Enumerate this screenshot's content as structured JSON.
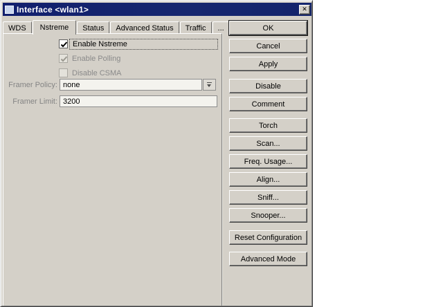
{
  "colors": {
    "titlebar_blue": "#16276f",
    "dialog_bg": "#d4d0c8",
    "field_bg": "#f4f3ee",
    "disabled_text": "#848484",
    "text": "#000000"
  },
  "window": {
    "title": "Interface <wlan1>"
  },
  "icons": {
    "close": "✕",
    "dropdown": "combo-down-arrow"
  },
  "tabs": [
    {
      "label": "WDS",
      "active": false
    },
    {
      "label": "Nstreme",
      "active": true
    },
    {
      "label": "Status",
      "active": false
    },
    {
      "label": "Advanced Status",
      "active": false
    },
    {
      "label": "Traffic",
      "active": false
    },
    {
      "label": "...",
      "active": false
    }
  ],
  "form": {
    "checkboxes": [
      {
        "label": "Enable Nstreme",
        "checked": true,
        "disabled": false,
        "focused": true
      },
      {
        "label": "Enable Polling",
        "checked": true,
        "disabled": true,
        "focused": false
      },
      {
        "label": "Disable CSMA",
        "checked": false,
        "disabled": true,
        "focused": false
      }
    ],
    "framer_policy": {
      "label": "Framer Policy:",
      "value": "none"
    },
    "framer_limit": {
      "label": "Framer Limit:",
      "value": "3200"
    }
  },
  "buttons": {
    "ok": "OK",
    "cancel": "Cancel",
    "apply": "Apply",
    "disable": "Disable",
    "comment": "Comment",
    "torch": "Torch",
    "scan": "Scan...",
    "freq_usage": "Freq. Usage...",
    "align": "Align...",
    "sniff": "Sniff...",
    "snooper": "Snooper...",
    "reset_configuration": "Reset Configuration",
    "advanced_mode": "Advanced Mode"
  }
}
